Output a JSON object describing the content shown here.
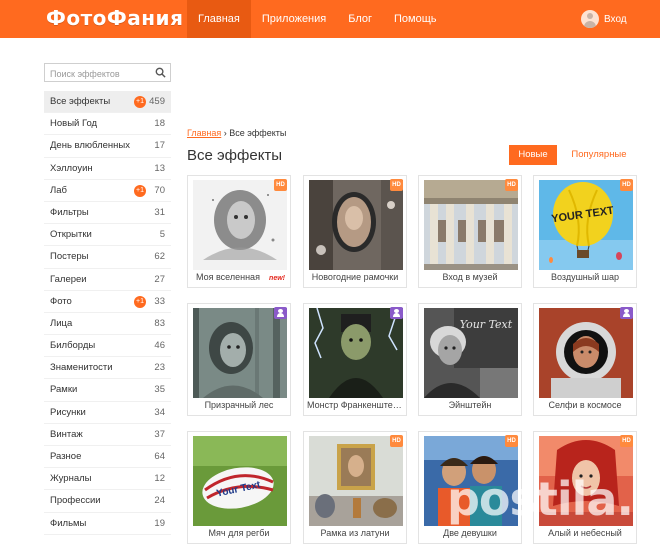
{
  "header": {
    "logo": "ФотоФания",
    "nav": [
      "Главная",
      "Приложения",
      "Блог",
      "Помощь"
    ],
    "login_label": "Вход"
  },
  "search": {
    "placeholder": "Поиск эффектов"
  },
  "sidebar": {
    "items": [
      {
        "label": "Все эффекты",
        "count": "459",
        "badge": "+1"
      },
      {
        "label": "Новый Год",
        "count": "18"
      },
      {
        "label": "День влюбленных",
        "count": "17"
      },
      {
        "label": "Хэллоуин",
        "count": "13"
      },
      {
        "label": "Лаб",
        "count": "70",
        "badge": "+1"
      },
      {
        "label": "Фильтры",
        "count": "31"
      },
      {
        "label": "Открытки",
        "count": "5"
      },
      {
        "label": "Постеры",
        "count": "62"
      },
      {
        "label": "Галереи",
        "count": "27"
      },
      {
        "label": "Фото",
        "count": "33",
        "badge": "+1"
      },
      {
        "label": "Лица",
        "count": "83"
      },
      {
        "label": "Билборды",
        "count": "46"
      },
      {
        "label": "Знаменитости",
        "count": "23"
      },
      {
        "label": "Рамки",
        "count": "35"
      },
      {
        "label": "Рисунки",
        "count": "34"
      },
      {
        "label": "Винтаж",
        "count": "37"
      },
      {
        "label": "Разное",
        "count": "64"
      },
      {
        "label": "Журналы",
        "count": "12"
      },
      {
        "label": "Профессии",
        "count": "24"
      },
      {
        "label": "Фильмы",
        "count": "19"
      }
    ]
  },
  "main": {
    "breadcrumb_link": "Главная",
    "breadcrumb_sep": "›",
    "breadcrumb_current": "Все эффекты",
    "title": "Все эффекты",
    "sort_new": "Новые",
    "sort_popular": "Популярные",
    "new_tag": "new!",
    "hd_label": "HD",
    "thumb_texts": {
      "balloon": "YOUR TEXT",
      "chalk": "Your Text",
      "ball": "Your Text"
    },
    "watermark": "postila.ru",
    "cards": [
      {
        "caption": "Моя вселенная",
        "badge": "hd",
        "icon": "universe-portrait-thumb",
        "new": true
      },
      {
        "caption": "Новогодние рамочки",
        "badge": "hd",
        "icon": "new-year-frame-thumb"
      },
      {
        "caption": "Вход в музей",
        "badge": "hd",
        "icon": "museum-entrance-thumb"
      },
      {
        "caption": "Воздушный шар",
        "badge": "hd",
        "icon": "hot-air-balloon-thumb"
      },
      {
        "caption": "Призрачный лес",
        "badge": "user",
        "icon": "ghost-forest-thumb"
      },
      {
        "caption": "Монстр Франкенштейна",
        "badge": "user",
        "icon": "frankenstein-thumb"
      },
      {
        "caption": "Эйнштейн",
        "badge": "",
        "icon": "einstein-chalkboard-thumb"
      },
      {
        "caption": "Селфи в космосе",
        "badge": "user",
        "icon": "space-selfie-thumb"
      },
      {
        "caption": "Мяч для регби",
        "badge": "",
        "icon": "rugby-ball-thumb"
      },
      {
        "caption": "Рамка из латуни",
        "badge": "hd",
        "icon": "brass-frame-thumb"
      },
      {
        "caption": "Две девушки",
        "badge": "hd",
        "icon": "two-girls-thumb"
      },
      {
        "caption": "Алый и небесный",
        "badge": "hd",
        "icon": "scarlet-sky-thumb"
      }
    ]
  },
  "colors": {
    "accent": "#ff6a1f",
    "accent_dark": "#e85a12",
    "user_badge": "#8a5ac9"
  }
}
